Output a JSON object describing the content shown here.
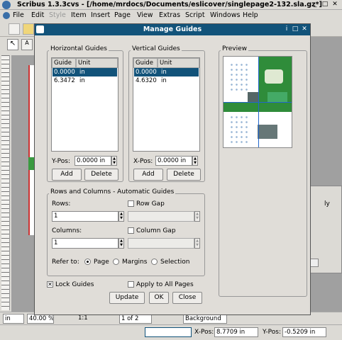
{
  "app": {
    "title": "Scribus 1.3.3cvs - [/home/mrdocs/Documents/eslicover/singlepage2-132.sla.gz*]",
    "menu": [
      "File",
      "Edit",
      "Style",
      "Item",
      "Insert",
      "Page",
      "View",
      "Extras",
      "Script",
      "Windows",
      "Help"
    ]
  },
  "dialog": {
    "title": "Manage Guides",
    "horizontal": {
      "title": "Horizontal Guides",
      "col_guide": "Guide",
      "col_unit": "Unit",
      "rows": [
        {
          "value": "0.0000",
          "unit": "in"
        },
        {
          "value": "6.3472",
          "unit": "in"
        }
      ],
      "pos_label": "Y-Pos:",
      "pos_value": "0.0000 in",
      "add": "Add",
      "delete": "Delete"
    },
    "vertical": {
      "title": "Vertical Guides",
      "col_guide": "Guide",
      "col_unit": "Unit",
      "rows": [
        {
          "value": "0.0000",
          "unit": "in"
        },
        {
          "value": "4.6320",
          "unit": "in"
        }
      ],
      "pos_label": "X-Pos:",
      "pos_value": "0.0000 in",
      "add": "Add",
      "delete": "Delete"
    },
    "preview": {
      "title": "Preview"
    },
    "rows_cols": {
      "title": "Rows and Columns - Automatic Guides",
      "rows_label": "Rows:",
      "rows_value": "1",
      "row_gap": "Row Gap",
      "columns_label": "Columns:",
      "columns_value": "1",
      "column_gap": "Column Gap",
      "refer_to": "Refer to:",
      "opt_page": "Page",
      "opt_margins": "Margins",
      "opt_selection": "Selection"
    },
    "lock_guides": "Lock Guides",
    "apply_all": "Apply to All Pages",
    "update": "Update",
    "ok": "OK",
    "close": "Close"
  },
  "bottom": {
    "unit": "in",
    "zoom": "40.00 %",
    "page": "1 of 2",
    "layer": "Background",
    "one_to_one": "1:1"
  },
  "status": {
    "xpos_label": "X-Pos:",
    "xpos_value": "8.7709 in",
    "ypos_label": "Y-Pos:",
    "ypos_value": "-0.5209 in"
  },
  "right_panel_text": "ly"
}
